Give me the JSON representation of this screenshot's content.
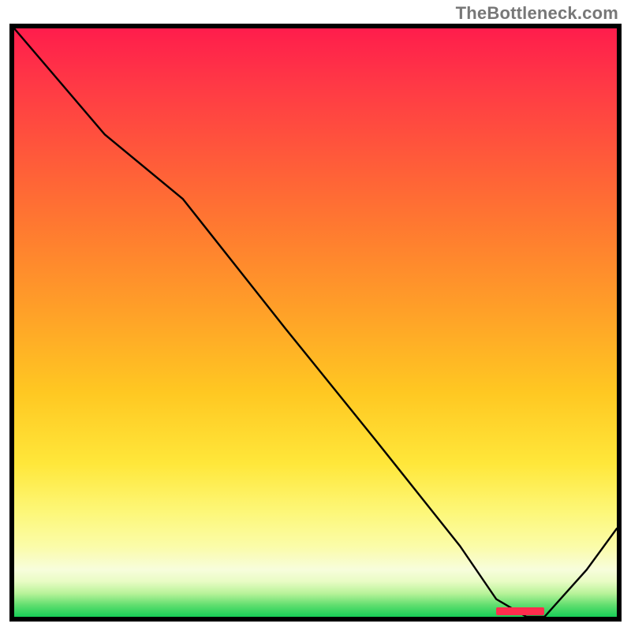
{
  "attribution": "TheBottleneck.com",
  "chart_data": {
    "type": "line",
    "title": "",
    "xlabel": "",
    "ylabel": "",
    "x": [
      0.0,
      0.05,
      0.15,
      0.28,
      0.45,
      0.6,
      0.74,
      0.8,
      0.85,
      0.88,
      0.95,
      1.0
    ],
    "values": [
      1.0,
      0.94,
      0.82,
      0.71,
      0.49,
      0.3,
      0.12,
      0.03,
      0.0,
      0.0,
      0.08,
      0.15
    ],
    "xlim": [
      0,
      1
    ],
    "ylim": [
      0,
      1
    ],
    "optimum_range_x": [
      0.8,
      0.88
    ],
    "gradient_stops": [
      {
        "pos": 0.0,
        "color": "#ff1d4c"
      },
      {
        "pos": 0.5,
        "color": "#ffa028"
      },
      {
        "pos": 0.8,
        "color": "#fdf777"
      },
      {
        "pos": 1.0,
        "color": "#18cf57"
      }
    ]
  }
}
